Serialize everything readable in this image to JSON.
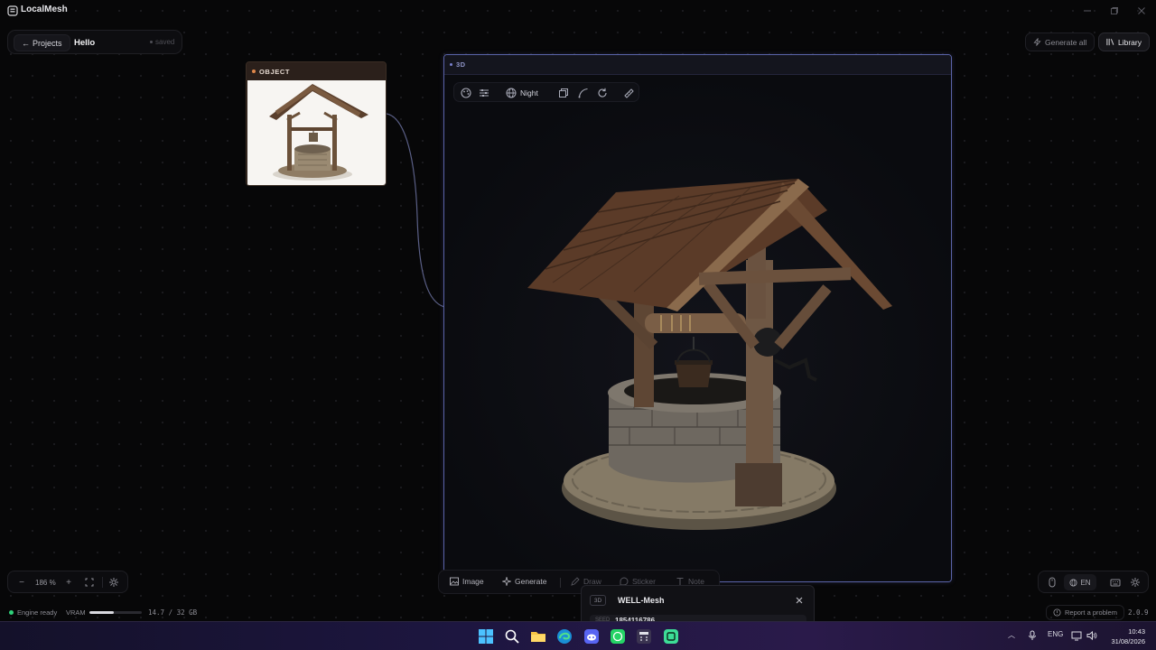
{
  "app": {
    "title": "LocalMesh"
  },
  "project": {
    "back_label": "Projects",
    "name": "Hello",
    "status": "saved"
  },
  "top_actions": {
    "generate_all": "Generate all",
    "library": "Library"
  },
  "object_node": {
    "header": "OBJECT",
    "image_icon": "wishing-well-image"
  },
  "viewport": {
    "header": "3D",
    "toolbar": {
      "icons": [
        "palette-icon",
        "sliders-icon",
        "globe-icon",
        "layers-icon",
        "curve-icon",
        "rotate-icon",
        "ruler-icon"
      ],
      "environment": "Night"
    }
  },
  "dock": {
    "items": [
      {
        "label": "Image",
        "icon": "image-icon"
      },
      {
        "label": "Generate",
        "icon": "sparkle-icon"
      },
      {
        "label": "Draw",
        "icon": "pencil-icon"
      },
      {
        "label": "Sticker",
        "icon": "sticker-icon"
      },
      {
        "label": "Note",
        "icon": "text-icon"
      }
    ]
  },
  "mesh_panel": {
    "badge": "3D",
    "title": "WELL-Mesh",
    "seed_label": "SEED",
    "seed": "1854116786"
  },
  "zoom": {
    "value": "186 %"
  },
  "bottom_right": {
    "language": "EN"
  },
  "status": {
    "engine": "Engine ready",
    "vram_label": "VRAM",
    "vram_text": "14.7 / 32 GB",
    "vram_fraction": 0.46,
    "report": "Report a problem",
    "version": "2.0.9"
  },
  "taskbar": {
    "apps": [
      "windows-start-icon",
      "search-icon",
      "file-explorer-icon",
      "edge-browser-icon",
      "discord-icon",
      "whatsapp-icon",
      "calculator-icon",
      "localmesh-icon"
    ],
    "tray_lang": "ENG",
    "time": "10:43",
    "date": "31/08/2026"
  },
  "colors": {
    "accent": "#5a63a8",
    "status_ok": "#2fd27a",
    "object_accent": "#e0874a"
  }
}
